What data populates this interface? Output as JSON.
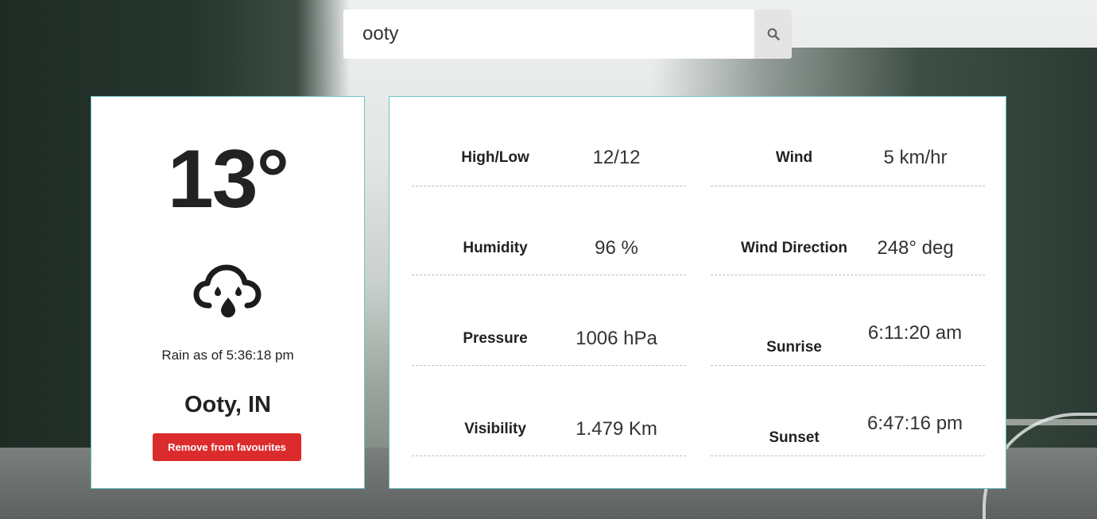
{
  "search": {
    "value": "ooty",
    "button_icon": "search-icon"
  },
  "current": {
    "temperature": "13°",
    "icon": "cloud-rain-icon",
    "condition_text": "Rain as of 5:36:18 pm",
    "city": "Ooty, IN",
    "remove_button": "Remove from favourites"
  },
  "details": [
    {
      "label": "High/Low",
      "value": "12/12"
    },
    {
      "label": "Wind",
      "value": "5 km/hr"
    },
    {
      "label": "Humidity",
      "value": "96 %"
    },
    {
      "label": "Wind Direction",
      "value": "248° deg"
    },
    {
      "label": "Pressure",
      "value": "1006 hPa"
    },
    {
      "label": "Sunrise",
      "value": "6:11:20 am"
    },
    {
      "label": "Visibility",
      "value": "1.479 Km"
    },
    {
      "label": "Sunset",
      "value": "6:47:16 pm"
    }
  ],
  "colors": {
    "accent_red": "#dc2b2c",
    "card_border": "#6fc2c4"
  }
}
